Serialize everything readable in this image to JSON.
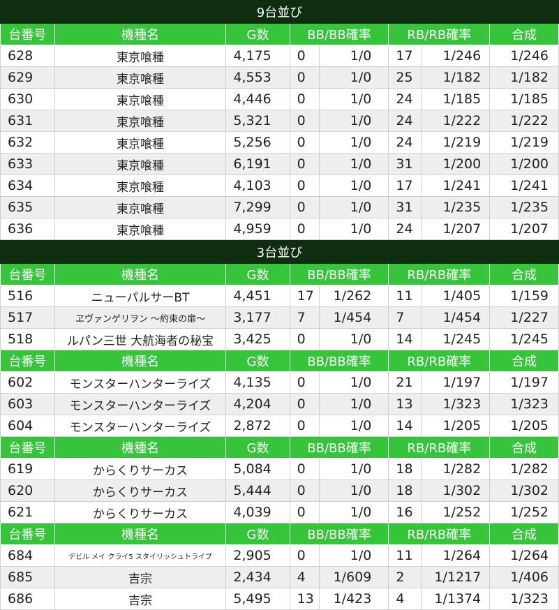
{
  "tables": [
    {
      "title": "9台並び",
      "groups": [
        {
          "rows": [
            {
              "id": "628",
              "name": "東京喰種",
              "g": "4,175",
              "bb": "0",
              "bbr": "1/0",
              "rb": "17",
              "rbr": "1/246",
              "tot": "1/246"
            },
            {
              "id": "629",
              "name": "東京喰種",
              "g": "4,553",
              "bb": "0",
              "bbr": "1/0",
              "rb": "25",
              "rbr": "1/182",
              "tot": "1/182"
            },
            {
              "id": "630",
              "name": "東京喰種",
              "g": "4,446",
              "bb": "0",
              "bbr": "1/0",
              "rb": "24",
              "rbr": "1/185",
              "tot": "1/185"
            },
            {
              "id": "631",
              "name": "東京喰種",
              "g": "5,321",
              "bb": "0",
              "bbr": "1/0",
              "rb": "24",
              "rbr": "1/222",
              "tot": "1/222"
            },
            {
              "id": "632",
              "name": "東京喰種",
              "g": "5,256",
              "bb": "0",
              "bbr": "1/0",
              "rb": "24",
              "rbr": "1/219",
              "tot": "1/219"
            },
            {
              "id": "633",
              "name": "東京喰種",
              "g": "6,191",
              "bb": "0",
              "bbr": "1/0",
              "rb": "31",
              "rbr": "1/200",
              "tot": "1/200"
            },
            {
              "id": "634",
              "name": "東京喰種",
              "g": "4,103",
              "bb": "0",
              "bbr": "1/0",
              "rb": "17",
              "rbr": "1/241",
              "tot": "1/241"
            },
            {
              "id": "635",
              "name": "東京喰種",
              "g": "7,299",
              "bb": "0",
              "bbr": "1/0",
              "rb": "31",
              "rbr": "1/235",
              "tot": "1/235"
            },
            {
              "id": "636",
              "name": "東京喰種",
              "g": "4,959",
              "bb": "0",
              "bbr": "1/0",
              "rb": "24",
              "rbr": "1/207",
              "tot": "1/207"
            }
          ]
        }
      ]
    },
    {
      "title": "3台並び",
      "groups": [
        {
          "rows": [
            {
              "id": "516",
              "name": "ニューパルサーBT",
              "g": "4,451",
              "bb": "17",
              "bbr": "1/262",
              "rb": "11",
              "rbr": "1/405",
              "tot": "1/159"
            },
            {
              "id": "517",
              "name": "ヱヴァンゲリヲン ～約束の扉～",
              "g": "3,177",
              "bb": "7",
              "bbr": "1/454",
              "rb": "7",
              "rbr": "1/454",
              "tot": "1/227",
              "size": "small"
            },
            {
              "id": "518",
              "name": "ルパン三世 大航海者の秘宝",
              "g": "3,425",
              "bb": "0",
              "bbr": "1/0",
              "rb": "14",
              "rbr": "1/245",
              "tot": "1/245"
            }
          ]
        },
        {
          "rows": [
            {
              "id": "602",
              "name": "モンスターハンターライズ",
              "g": "4,135",
              "bb": "0",
              "bbr": "1/0",
              "rb": "21",
              "rbr": "1/197",
              "tot": "1/197"
            },
            {
              "id": "603",
              "name": "モンスターハンターライズ",
              "g": "4,204",
              "bb": "0",
              "bbr": "1/0",
              "rb": "13",
              "rbr": "1/323",
              "tot": "1/323"
            },
            {
              "id": "604",
              "name": "モンスターハンターライズ",
              "g": "2,872",
              "bb": "0",
              "bbr": "1/0",
              "rb": "14",
              "rbr": "1/205",
              "tot": "1/205"
            }
          ]
        },
        {
          "rows": [
            {
              "id": "619",
              "name": "からくりサーカス",
              "g": "5,084",
              "bb": "0",
              "bbr": "1/0",
              "rb": "18",
              "rbr": "1/282",
              "tot": "1/282"
            },
            {
              "id": "620",
              "name": "からくりサーカス",
              "g": "5,444",
              "bb": "0",
              "bbr": "1/0",
              "rb": "18",
              "rbr": "1/302",
              "tot": "1/302"
            },
            {
              "id": "621",
              "name": "からくりサーカス",
              "g": "4,039",
              "bb": "0",
              "bbr": "1/0",
              "rb": "16",
              "rbr": "1/252",
              "tot": "1/252"
            }
          ]
        },
        {
          "rows": [
            {
              "id": "684",
              "name": "デビル メイ クライ5 スタイリッシュトライブ",
              "g": "2,905",
              "bb": "0",
              "bbr": "1/0",
              "rb": "11",
              "rbr": "1/264",
              "tot": "1/264",
              "size": "tiny"
            },
            {
              "id": "685",
              "name": "吉宗",
              "g": "2,434",
              "bb": "4",
              "bbr": "1/609",
              "rb": "2",
              "rbr": "1/1217",
              "tot": "1/406"
            },
            {
              "id": "686",
              "name": "吉宗",
              "g": "5,495",
              "bb": "13",
              "bbr": "1/423",
              "rb": "4",
              "rbr": "1/1374",
              "tot": "1/323"
            }
          ]
        }
      ]
    }
  ],
  "columns": {
    "id": "台番号",
    "name": "機種名",
    "g": "G数",
    "bb": "BB/BB確率",
    "rb": "RB/RB確率",
    "tot": "合成"
  },
  "colors": {
    "section_bg": "#0e2e10",
    "header_bg": "#35c43a",
    "alt_row": "#eeeeee"
  }
}
